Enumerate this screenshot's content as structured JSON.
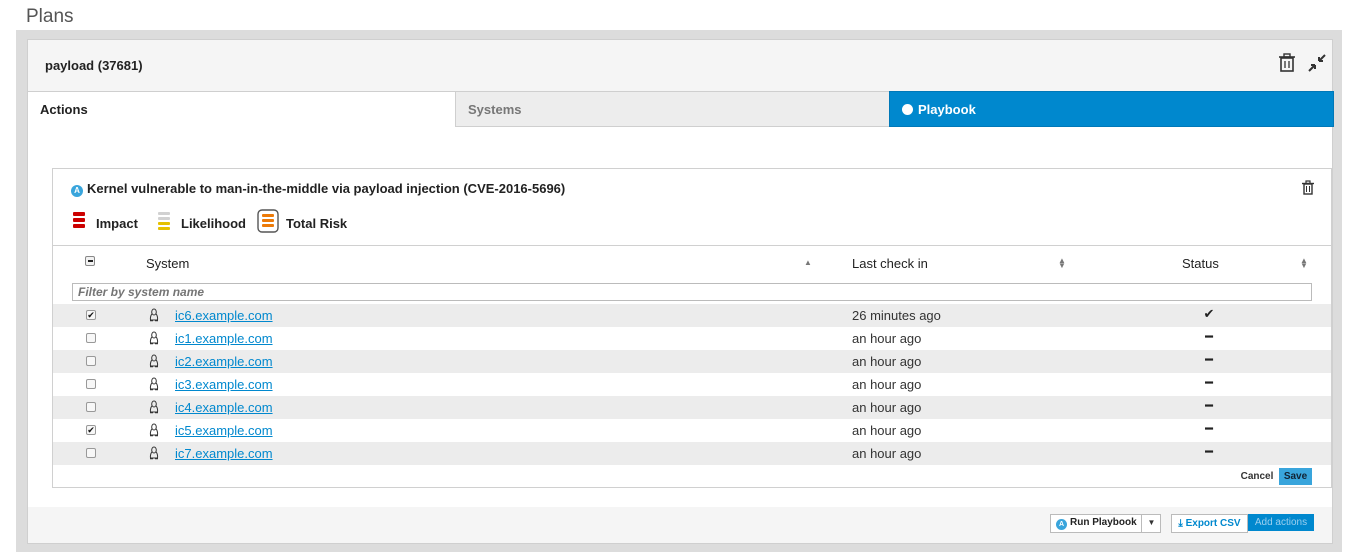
{
  "page": {
    "title": "Plans"
  },
  "plan": {
    "title": "payload (37681)"
  },
  "tabs": [
    {
      "label": "Actions"
    },
    {
      "label": "Systems"
    },
    {
      "label": "Playbook"
    }
  ],
  "rule": {
    "badge": "A",
    "title": "Kernel vulnerable to man-in-the-middle via payload injection (CVE-2016-5696)",
    "risk": {
      "impact": "Impact",
      "likelihood": "Likelihood",
      "total": "Total Risk"
    }
  },
  "colors": {
    "impact": "#cc0000",
    "likelihood": "#e5c100",
    "total": "#ec7a08",
    "accent": "#0088ce"
  },
  "table": {
    "headers": {
      "system": "System",
      "last_check": "Last check in",
      "status": "Status"
    },
    "filter_placeholder": "Filter by system name",
    "rows": [
      {
        "checked": true,
        "os_icon": "linux-icon",
        "system": "ic6.example.com",
        "last_check": "26 minutes ago",
        "status": "✔"
      },
      {
        "checked": false,
        "os_icon": "linux-icon",
        "system": "ic1.example.com",
        "last_check": "an hour ago",
        "status": "━"
      },
      {
        "checked": false,
        "os_icon": "linux-icon",
        "system": "ic2.example.com",
        "last_check": "an hour ago",
        "status": "━"
      },
      {
        "checked": false,
        "os_icon": "linux-icon",
        "system": "ic3.example.com",
        "last_check": "an hour ago",
        "status": "━"
      },
      {
        "checked": false,
        "os_icon": "linux-icon",
        "system": "ic4.example.com",
        "last_check": "an hour ago",
        "status": "━"
      },
      {
        "checked": true,
        "os_icon": "linux-icon",
        "system": "ic5.example.com",
        "last_check": "an hour ago",
        "status": "━"
      },
      {
        "checked": false,
        "os_icon": "linux-icon",
        "system": "ic7.example.com",
        "last_check": "an hour ago",
        "status": "━"
      }
    ]
  },
  "buttons": {
    "cancel": "Cancel",
    "save": "Save",
    "run_playbook": "Run Playbook",
    "run_badge": "A",
    "export_csv": "Export CSV",
    "add_actions": "Add actions"
  }
}
